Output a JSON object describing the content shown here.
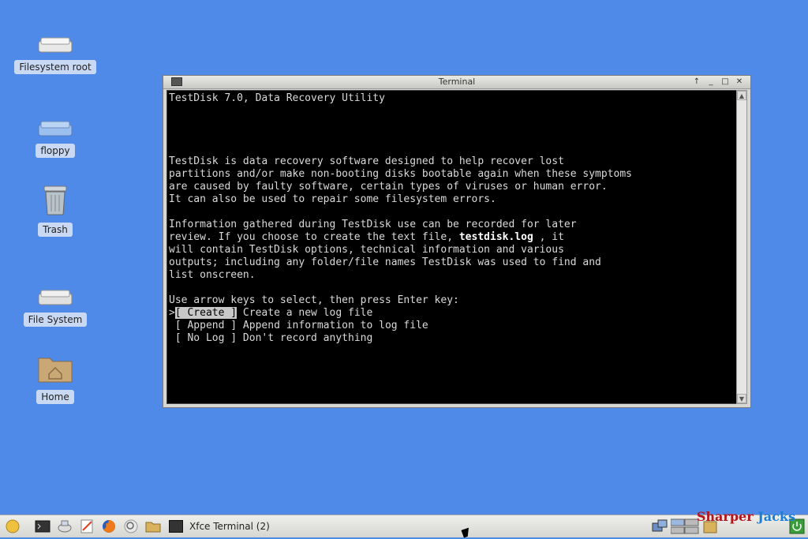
{
  "desktop": {
    "icons": [
      {
        "label": "Filesystem root",
        "icon": "drive-icon"
      },
      {
        "label": "floppy",
        "icon": "floppy-icon"
      },
      {
        "label": "Trash",
        "icon": "trash-icon"
      },
      {
        "label": "File System",
        "icon": "drive-icon"
      },
      {
        "label": "Home",
        "icon": "home-folder-icon"
      }
    ]
  },
  "window": {
    "title": "Terminal",
    "controls": [
      "↑",
      "_",
      "□",
      "✕"
    ]
  },
  "terminal": {
    "lines": [
      "TestDisk 7.0, Data Recovery Utility",
      "",
      "",
      "",
      "",
      "TestDisk is data recovery software designed to help recover lost",
      "partitions and/or make non-booting disks bootable again when these symptoms",
      "are caused by faulty software, certain types of viruses or human error.",
      "It can also be used to repair some filesystem errors.",
      "",
      "Information gathered during TestDisk use can be recorded for later",
      "review. If you choose to create the text file,",
      "will contain TestDisk options, technical information and various",
      "outputs; including any folder/file names TestDisk was used to find and",
      "list onscreen.",
      "",
      "Use arrow keys to select, then press Enter key:"
    ],
    "log_file_name": "testdisk.log",
    "log_file_suffix": " , it",
    "menu": [
      {
        "prefix": ">",
        "button": "[ Create ]",
        "desc": " Create a new log file",
        "selected": true
      },
      {
        "prefix": " ",
        "button": "[ Append ]",
        "desc": " Append information to log file",
        "selected": false
      },
      {
        "prefix": " ",
        "button": "[ No Log ]",
        "desc": " Don't record anything",
        "selected": false
      }
    ]
  },
  "taskbar": {
    "task_label": "Xfce Terminal (2)",
    "watermark_a": "Sharper ",
    "watermark_b": "Jacks"
  }
}
